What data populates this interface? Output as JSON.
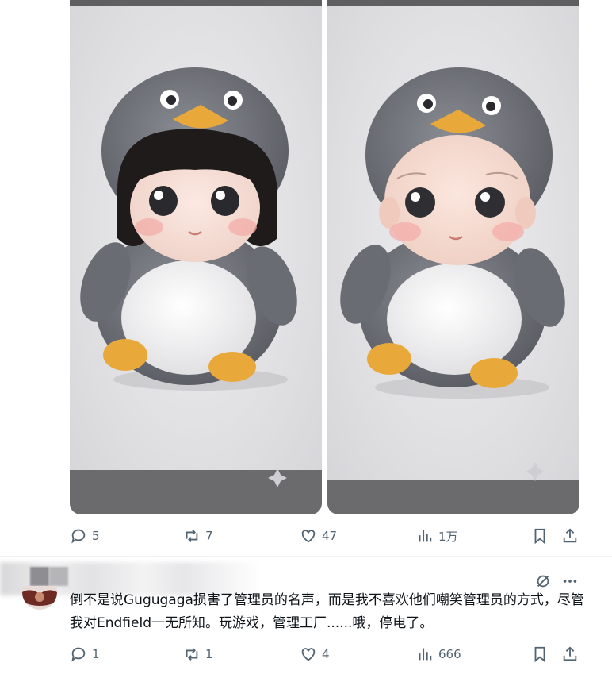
{
  "posts": [
    {
      "stats": {
        "replies": "5",
        "reposts": "7",
        "likes": "47",
        "views": "1万"
      }
    },
    {
      "text": "倒不是说Gugugaga损害了管理员的名声，而是我不喜欢他们嘲笑管理员的方式，尽管我对Endfield一无所知。玩游戏，管理工厂......哦，停电了。",
      "stats": {
        "replies": "1",
        "reposts": "1",
        "likes": "4",
        "views": "666"
      }
    }
  ],
  "colors": {
    "icon": "#536471",
    "text": "#0f1419",
    "penguin_gray": "#6d6f76",
    "beak": "#e8a93a"
  },
  "icons": [
    "reply-icon",
    "repost-icon",
    "like-icon",
    "views-icon",
    "bookmark-icon",
    "share-icon",
    "grok-icon",
    "more-icon"
  ]
}
